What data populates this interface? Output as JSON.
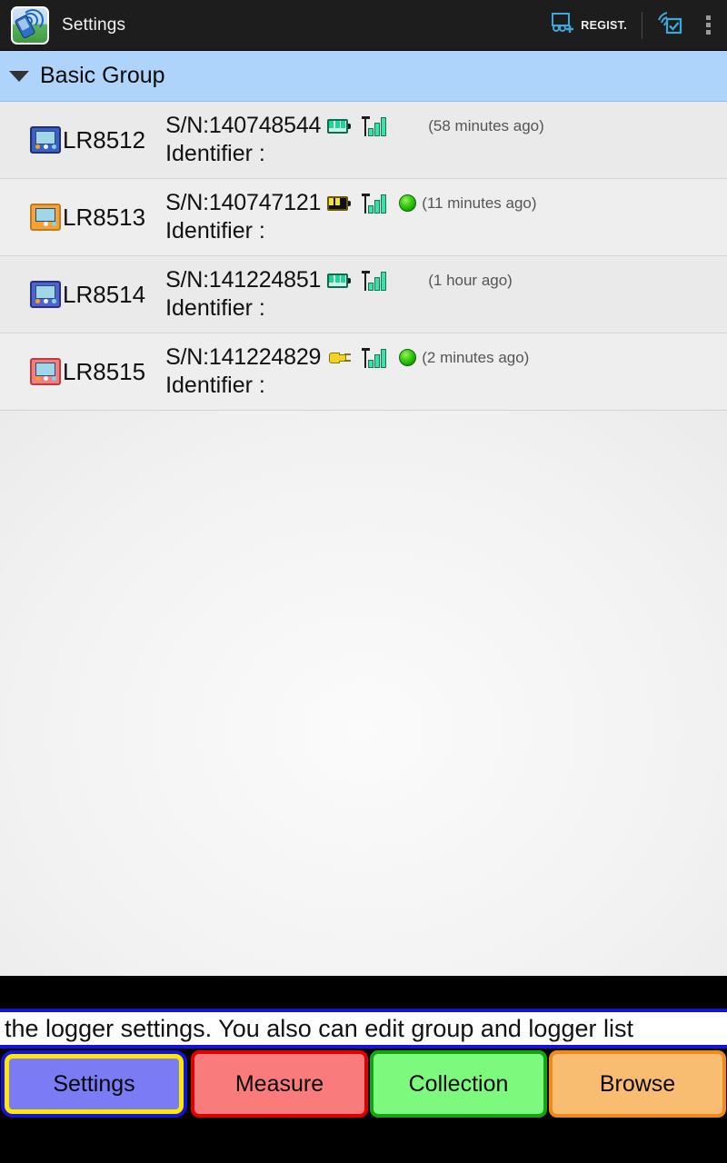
{
  "actionbar": {
    "app_icon": "logger-app-icon",
    "title": "Settings",
    "regist_label": "REGIST.",
    "regist_icon": "add-device-icon",
    "wireless_check_icon": "wireless-check-icon",
    "overflow_icon": "overflow-menu-icon"
  },
  "group": {
    "expand_icon": "triangle-down-icon",
    "name": "Basic Group"
  },
  "loggers": [
    {
      "name": "LR8512",
      "device_icon": "logger-device-icon",
      "device_color": "#3b5fc8",
      "serial": "S/N:140748544",
      "power_icon": "battery-full-icon",
      "power_state": "full",
      "signal_icon": "signal-bars-icon",
      "status_icon": null,
      "last_seen": "(58 minutes ago)",
      "identifier_label": "Identifier :",
      "identifier_value": ""
    },
    {
      "name": "LR8513",
      "device_icon": "logger-device-icon",
      "device_color": "#f2a33c",
      "serial": "S/N:140747121",
      "power_icon": "battery-low-icon",
      "power_state": "partial",
      "signal_icon": "signal-bars-icon",
      "status_icon": "green-status-icon",
      "last_seen": "(11 minutes ago)",
      "identifier_label": "Identifier :",
      "identifier_value": ""
    },
    {
      "name": "LR8514",
      "device_icon": "logger-device-icon",
      "device_color": "#4f63cf",
      "serial": "S/N:141224851",
      "power_icon": "battery-full-icon",
      "power_state": "full",
      "signal_icon": "signal-bars-icon",
      "status_icon": null,
      "last_seen": "(1 hour ago)",
      "identifier_label": "Identifier :",
      "identifier_value": ""
    },
    {
      "name": "LR8515",
      "device_icon": "logger-device-icon",
      "device_color": "#f08080",
      "serial": "S/N:141224829",
      "power_icon": "ac-power-icon",
      "power_state": "ac",
      "signal_icon": "signal-bars-icon",
      "status_icon": "green-status-icon",
      "last_seen": "(2 minutes ago)",
      "identifier_label": "Identifier :",
      "identifier_value": ""
    }
  ],
  "hint": {
    "text": "t the logger settings. You also can edit group and logger list"
  },
  "tabs": [
    {
      "label": "Settings",
      "selected": true,
      "fill": "#7b7bf5",
      "border": "#1414d8"
    },
    {
      "label": "Measure",
      "selected": false,
      "fill": "#f97b7b",
      "border": "#e00000"
    },
    {
      "label": "Collection",
      "selected": false,
      "fill": "#7df97d",
      "border": "#11a511"
    },
    {
      "label": "Browse",
      "selected": false,
      "fill": "#f9bd72",
      "border": "#ef8a1a"
    }
  ],
  "colors": {
    "actionbar_bg": "#1d1d1d",
    "group_header_bg": "#aed4fb",
    "list_bg": "#eaeaea",
    "accent_blue": "#1414d8",
    "selected_outline": "#ffe800"
  }
}
